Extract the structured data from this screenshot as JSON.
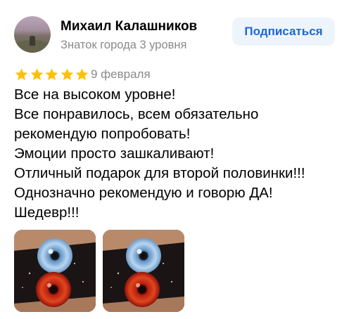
{
  "author": {
    "name": "Михаил Калашников",
    "level": "Знаток города 3 уровня",
    "avatar_icon": "user-avatar"
  },
  "subscribe_label": "Подписаться",
  "review": {
    "rating": 5,
    "rating_max": 5,
    "date": "9 февраля",
    "lines": [
      "Все на высоком уровне!",
      "Все понравилось, всем обязательно",
      "рекомендую попробовать!",
      "Эмоции просто зашкаливают!",
      "Отличный подарок для второй половинки!!!",
      "Однозначно рекомендую и говорю ДА!",
      "Шедевр!!!"
    ]
  },
  "photos_count": 2,
  "colors": {
    "star": "#ffc107",
    "subscribe_bg": "#eef4fc",
    "subscribe_text": "#1d66d4",
    "secondary_text": "#8a8a8a"
  }
}
